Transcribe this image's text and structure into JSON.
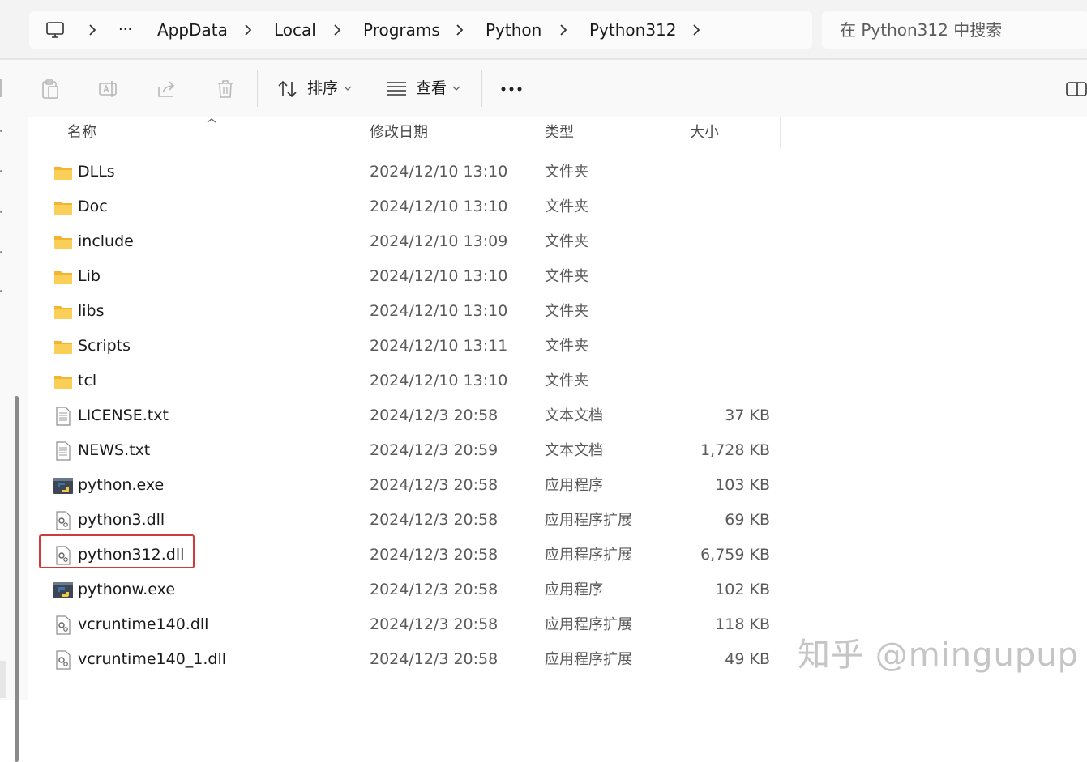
{
  "address": {
    "ellipsis": "···",
    "crumbs": [
      "AppData",
      "Local",
      "Programs",
      "Python",
      "Python312"
    ]
  },
  "search": {
    "placeholder": "在 Python312 中搜索"
  },
  "toolbar": {
    "sort_label": "排序",
    "view_label": "查看",
    "more_label": "···"
  },
  "columns": {
    "name": "名称",
    "modified": "修改日期",
    "type": "类型",
    "size": "大小"
  },
  "files": [
    {
      "name": "DLLs",
      "date": "2024/12/10 13:10",
      "type": "文件夹",
      "size": "",
      "icon": "folder-icon"
    },
    {
      "name": "Doc",
      "date": "2024/12/10 13:10",
      "type": "文件夹",
      "size": "",
      "icon": "folder-icon"
    },
    {
      "name": "include",
      "date": "2024/12/10 13:09",
      "type": "文件夹",
      "size": "",
      "icon": "folder-icon"
    },
    {
      "name": "Lib",
      "date": "2024/12/10 13:10",
      "type": "文件夹",
      "size": "",
      "icon": "folder-icon"
    },
    {
      "name": "libs",
      "date": "2024/12/10 13:10",
      "type": "文件夹",
      "size": "",
      "icon": "folder-icon"
    },
    {
      "name": "Scripts",
      "date": "2024/12/10 13:11",
      "type": "文件夹",
      "size": "",
      "icon": "folder-icon"
    },
    {
      "name": "tcl",
      "date": "2024/12/10 13:10",
      "type": "文件夹",
      "size": "",
      "icon": "folder-icon"
    },
    {
      "name": "LICENSE.txt",
      "date": "2024/12/3 20:58",
      "type": "文本文档",
      "size": "37 KB",
      "icon": "text-file-icon"
    },
    {
      "name": "NEWS.txt",
      "date": "2024/12/3 20:59",
      "type": "文本文档",
      "size": "1,728 KB",
      "icon": "text-file-icon"
    },
    {
      "name": "python.exe",
      "date": "2024/12/3 20:58",
      "type": "应用程序",
      "size": "103 KB",
      "icon": "python-exe-icon"
    },
    {
      "name": "python3.dll",
      "date": "2024/12/3 20:58",
      "type": "应用程序扩展",
      "size": "69 KB",
      "icon": "dll-file-icon"
    },
    {
      "name": "python312.dll",
      "date": "2024/12/3 20:58",
      "type": "应用程序扩展",
      "size": "6,759 KB",
      "icon": "dll-file-icon",
      "highlighted": true
    },
    {
      "name": "pythonw.exe",
      "date": "2024/12/3 20:58",
      "type": "应用程序",
      "size": "102 KB",
      "icon": "python-exe-icon"
    },
    {
      "name": "vcruntime140.dll",
      "date": "2024/12/3 20:58",
      "type": "应用程序扩展",
      "size": "118 KB",
      "icon": "dll-file-icon"
    },
    {
      "name": "vcruntime140_1.dll",
      "date": "2024/12/3 20:58",
      "type": "应用程序扩展",
      "size": "49 KB",
      "icon": "dll-file-icon"
    }
  ],
  "watermark": "知乎 @mingupup",
  "colors": {
    "folder": "#f5c542",
    "highlight_border": "#d03a3a",
    "python_blue": "#3a72b0",
    "python_yellow": "#f2c94c"
  }
}
